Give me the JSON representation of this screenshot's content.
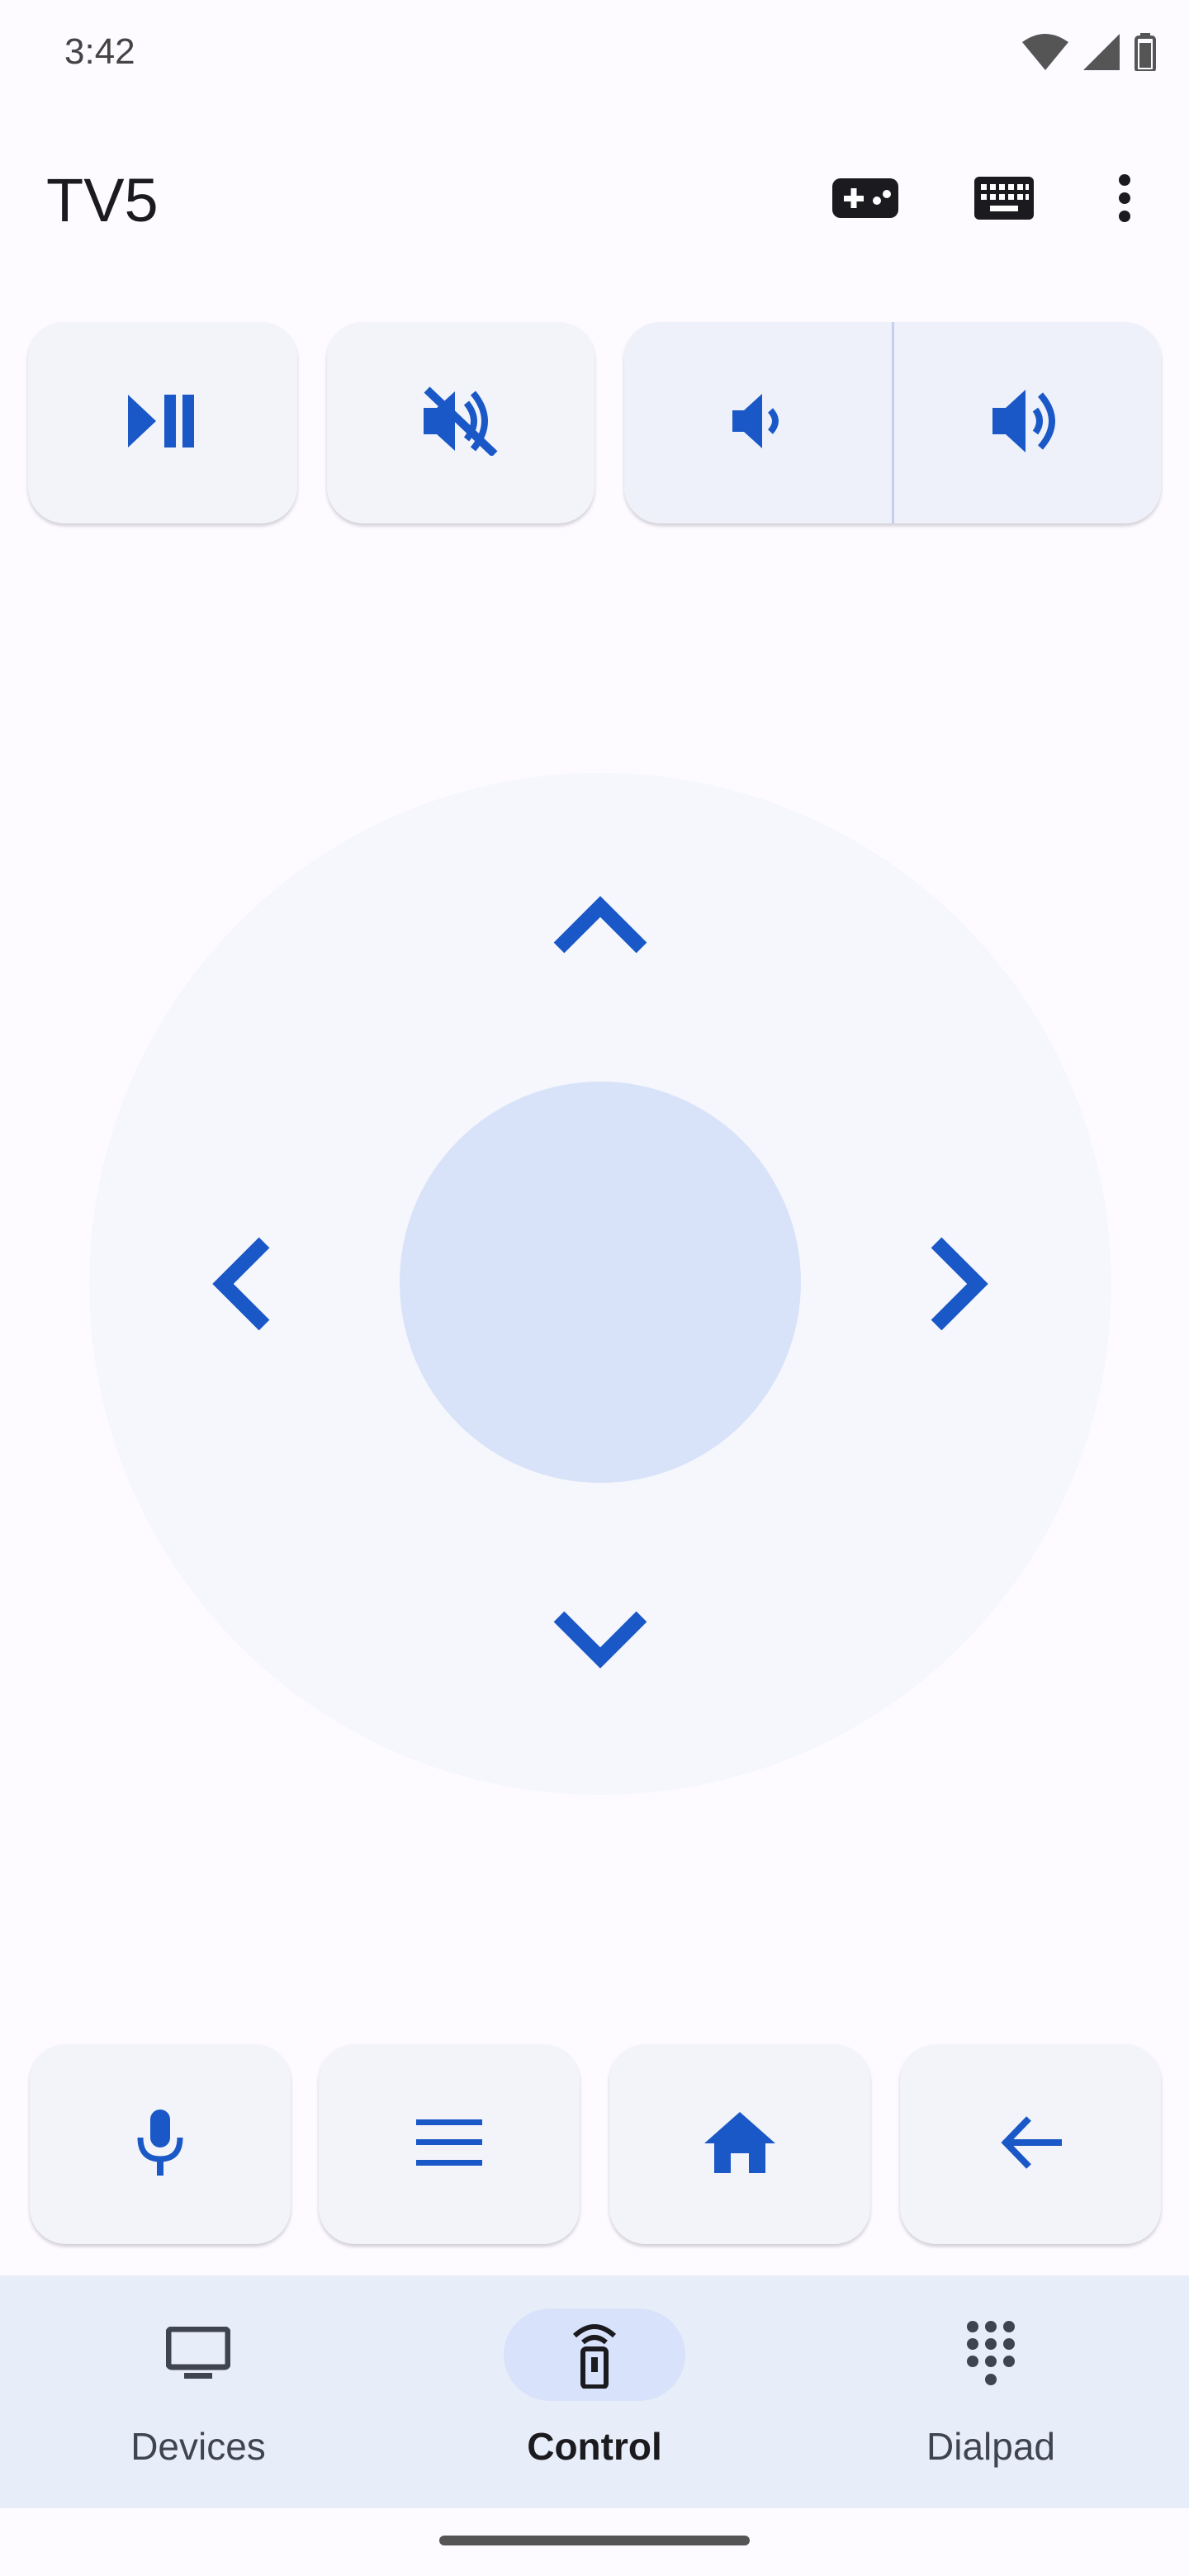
{
  "status_bar": {
    "time": "3:42",
    "icons": [
      "wifi-icon",
      "cell-signal-icon",
      "battery-icon"
    ]
  },
  "app_bar": {
    "title": "TV5",
    "actions": [
      "gamepad-icon",
      "keyboard-icon",
      "more-vert-icon"
    ]
  },
  "top_controls": [
    "play-pause-icon",
    "mute-icon",
    "volume-down-icon",
    "volume-up-icon"
  ],
  "dpad": {
    "arrows": [
      "chevron-up-icon",
      "chevron-left-icon",
      "chevron-right-icon",
      "chevron-down-icon"
    ]
  },
  "bottom_controls": [
    "mic-icon",
    "menu-icon",
    "home-icon",
    "back-arrow-icon"
  ],
  "nav": {
    "items": [
      {
        "label": "Devices",
        "icon": "tv-icon",
        "active": false
      },
      {
        "label": "Control",
        "icon": "remote-icon",
        "active": true
      },
      {
        "label": "Dialpad",
        "icon": "dialpad-icon",
        "active": false
      }
    ]
  },
  "colors": {
    "accent": "#1a57c7",
    "background": "#fdfbff",
    "button_bg": "#f2f4fa",
    "dpad_center": "#d8e2f9",
    "navbar_bg": "#e8eef9",
    "active_indicator": "#d8e2fa"
  }
}
